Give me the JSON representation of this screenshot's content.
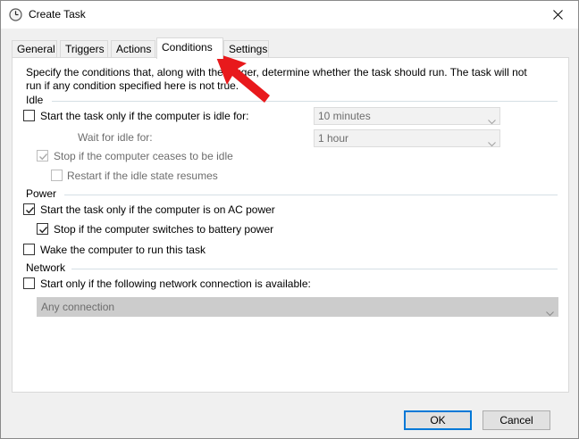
{
  "window": {
    "title": "Create Task",
    "icon": "clock-icon",
    "close_icon": "close-icon"
  },
  "tabs": [
    {
      "label": "General",
      "active": false
    },
    {
      "label": "Triggers",
      "active": false
    },
    {
      "label": "Actions",
      "active": false
    },
    {
      "label": "Conditions",
      "active": true
    },
    {
      "label": "Settings",
      "active": false
    }
  ],
  "conditions": {
    "description_line1": "Specify the conditions that, along with the trigger, determine whether the task should run.  The task will not",
    "description_line2": "run  if any condition specified here is not true.",
    "idle": {
      "group_label": "Idle",
      "start_if_idle_label": "Start the task only if the computer is idle for:",
      "start_if_idle_checked": false,
      "idle_for_value": "10 minutes",
      "wait_for_idle_label": "Wait for idle for:",
      "wait_for_idle_value": "1 hour",
      "stop_if_not_idle_label": "Stop if the computer ceases to be idle",
      "stop_if_not_idle_checked": true,
      "restart_on_idle_label": "Restart if the idle state resumes",
      "restart_on_idle_checked": false
    },
    "power": {
      "group_label": "Power",
      "ac_power_label": "Start the task only if the computer is on AC power",
      "ac_power_checked": true,
      "battery_stop_label": "Stop if the computer switches to battery power",
      "battery_stop_checked": true,
      "wake_label": "Wake the computer to run this task",
      "wake_checked": false
    },
    "network": {
      "group_label": "Network",
      "start_if_network_label": "Start only if the following network connection is available:",
      "start_if_network_checked": false,
      "connection_value": "Any connection"
    }
  },
  "buttons": {
    "ok_label": "OK",
    "cancel_label": "Cancel"
  },
  "colors": {
    "accent": "#0078d7",
    "annotation_arrow": "#e8191c",
    "group_line": "#d5dfe5"
  }
}
